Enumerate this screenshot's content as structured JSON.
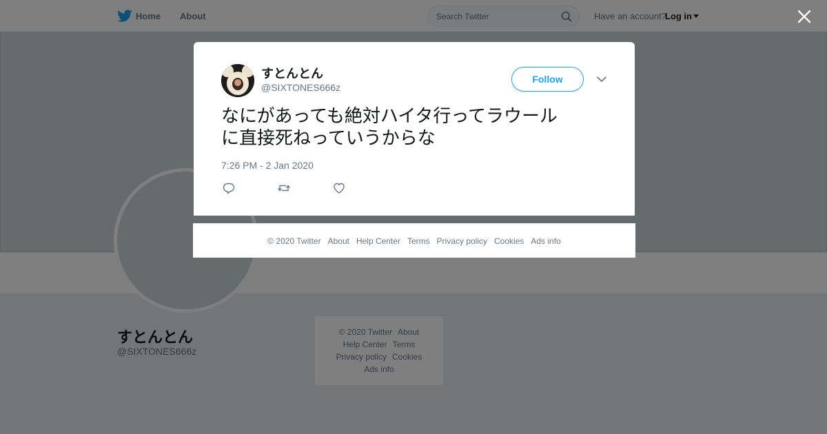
{
  "topbar": {
    "home_label": "Home",
    "about_label": "About",
    "search_placeholder": "Search Twitter",
    "account_prompt": "Have an account?",
    "login_label": "Log in"
  },
  "profile": {
    "name": "すとんとん",
    "handle": "@SIXTONES666z"
  },
  "side_footer": {
    "links": [
      "© 2020 Twitter",
      "About",
      "Help Center",
      "Terms",
      "Privacy policy",
      "Cookies",
      "Ads info"
    ]
  },
  "tweet": {
    "author_name": "すとんとん",
    "author_handle": "@SIXTONES666z",
    "follow_label": "Follow",
    "text_line1": "なにがあっても絶対ハイタ行ってラウール",
    "text_line2": "に直接死ねっていうからな",
    "timestamp": "7:26 PM - 2 Jan 2020"
  },
  "modal_footer": {
    "links": [
      "© 2020 Twitter",
      "About",
      "Help Center",
      "Terms",
      "Privacy policy",
      "Cookies",
      "Ads info"
    ]
  },
  "icons": {
    "brand": "twitter-bird-icon",
    "search": "search-icon",
    "close": "close-icon",
    "more": "chevron-down-icon",
    "reply": "reply-icon",
    "retweet": "retweet-icon",
    "like": "heart-icon"
  },
  "colors": {
    "brand_blue": "#1da1f2",
    "text_primary": "#14171a",
    "text_secondary": "#657786",
    "page_bg": "#e6ecf0"
  }
}
